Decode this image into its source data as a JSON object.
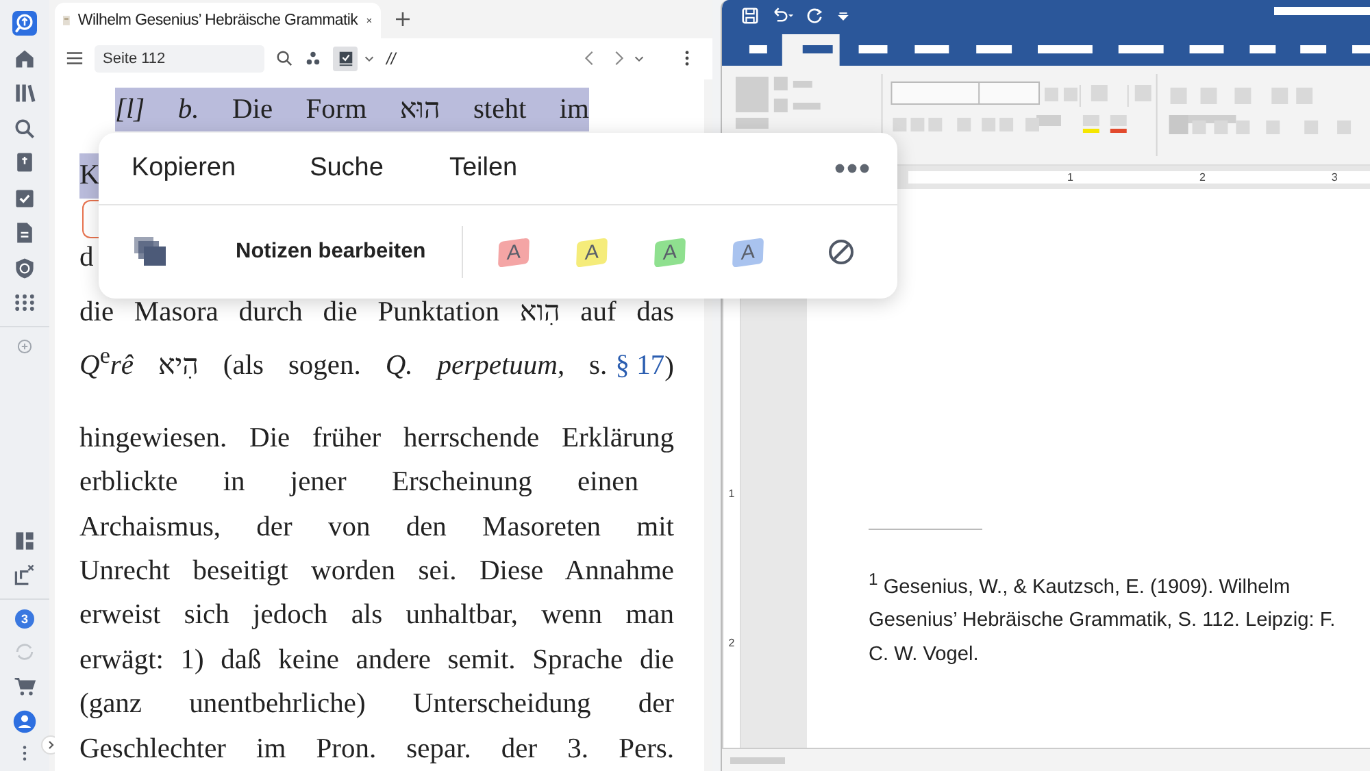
{
  "sidebar": {
    "badge": "3"
  },
  "tab": {
    "title": "Wilhelm Gesenius’ Hebräische Grammatik"
  },
  "toolbar": {
    "page_field": {
      "value": "Seite 112"
    },
    "parallel_label": "//"
  },
  "text_lines": [
    {
      "kind": "paragraph-start",
      "selected": true,
      "text": "*[l]*  *b.* Die Form הוּא steht im"
    },
    {
      "kind": "line",
      "selected": true,
      "text": "K"
    },
    {
      "kind": "line",
      "selected": false,
      "text": "d"
    },
    {
      "kind": "line",
      "selected": false,
      "text": "die Masora durch die Punktation הִוא auf das"
    },
    {
      "kind": "line",
      "selected": false,
      "text": "*Q*$^{e}$*rê* הִיא (als sogen. *Q. perpetuum*, s.",
      "link": "§ 17",
      "after": ")"
    },
    {
      "kind": "line",
      "selected": false,
      "text": "hingewiesen. Die früher herrschende Erklärung"
    },
    {
      "kind": "line",
      "selected": false,
      "text": "erblickte in jener Erscheinung einen"
    },
    {
      "kind": "line",
      "selected": false,
      "text": "Archaismus, der von den Masoreten mit"
    },
    {
      "kind": "line",
      "selected": false,
      "text": "Unrecht beseitigt worden sei. Diese Annahme"
    },
    {
      "kind": "line",
      "selected": false,
      "text": "erweist sich jedoch als unhaltbar, wenn man"
    },
    {
      "kind": "line",
      "selected": false,
      "text": "erwägt: 1) daß keine andere semit. Sprache die"
    },
    {
      "kind": "line",
      "selected": false,
      "text": "(ganz unentbehrliche) Unterscheidung der"
    },
    {
      "kind": "line",
      "selected": false,
      "text": "Geschlechter im Pron. separ. der 3. Pers."
    }
  ],
  "popup": {
    "actions": [
      "Kopieren",
      "Suche",
      "Teilen"
    ],
    "notes_label": "Notizen bearbeiten",
    "highlighters": [
      {
        "label": "A",
        "color": "#f4a5a5"
      },
      {
        "label": "A",
        "color": "#f5ec7a"
      },
      {
        "label": "A",
        "color": "#8fe08f"
      },
      {
        "label": "A",
        "color": "#a9c3ef"
      }
    ]
  },
  "word": {
    "ruler_marks": [
      "1",
      "2",
      "3"
    ],
    "vertical_ruler_marks": [
      "1",
      "2"
    ],
    "footnote": "$^{1}$ Gesenius, W., & Kautzsch, E. (1909). Wilhelm Gesenius’ Hebräische Grammatik, S. 112. Leipzig: F. C. W. Vogel."
  }
}
